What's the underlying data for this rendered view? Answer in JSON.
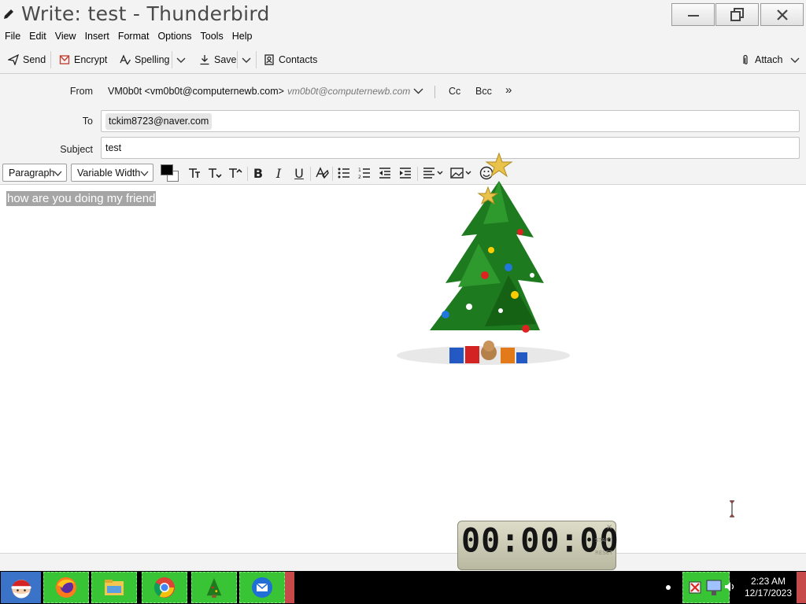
{
  "window": {
    "title": "Write: test - Thunderbird",
    "controls": [
      "minimize",
      "restore",
      "close"
    ]
  },
  "menubar": {
    "items": [
      {
        "label": "File"
      },
      {
        "label": "Edit"
      },
      {
        "label": "View"
      },
      {
        "label": "Insert"
      },
      {
        "label": "Format"
      },
      {
        "label": "Options"
      },
      {
        "label": "Tools"
      },
      {
        "label": "Help"
      }
    ]
  },
  "toolbar": {
    "send": "Send",
    "encrypt": "Encrypt",
    "spelling": "Spelling",
    "save": "Save",
    "contacts": "Contacts",
    "attach": "Attach"
  },
  "headers": {
    "from_label": "From",
    "from_value": "VM0b0t <vm0b0t@computernewb.com>",
    "from_hint": "vm0b0t@computernewb.com",
    "cc": "Cc",
    "bcc": "Bcc",
    "more": "»",
    "to_label": "To",
    "to_recipient": "tckim8723@naver.com",
    "subject_label": "Subject",
    "subject_value": "test"
  },
  "format_bar": {
    "paragraph": "Paragraph",
    "font": "Variable Width",
    "text_color": "#000000",
    "bg_color": "#ffffff",
    "icons": [
      "font-size-reset-icon",
      "font-smaller-icon",
      "font-larger-icon",
      "bold-icon",
      "italic-icon",
      "underline-icon",
      "remove-formatting-icon",
      "bulleted-list-icon",
      "numbered-list-icon",
      "outdent-icon",
      "indent-icon",
      "align-icon",
      "insert-image-icon",
      "smiley-icon"
    ]
  },
  "body": {
    "selected_text": "how are you doing my friend"
  },
  "timer_widget": {
    "display": "00:00:00",
    "start": "START",
    "reset": "RESET",
    "close": "×"
  },
  "taskbar": {
    "apps": [
      "santa-start-icon",
      "firefox-icon",
      "file-explorer-icon",
      "chrome-icon",
      "christmas-tree-icon",
      "thunderbird-icon"
    ],
    "time": "2:23 AM",
    "date": "12/17/2023"
  },
  "colors": {
    "chrome_bg": "#f3f3f3",
    "selection": "#a5a5a5",
    "taskbar_button": "#39c436"
  }
}
